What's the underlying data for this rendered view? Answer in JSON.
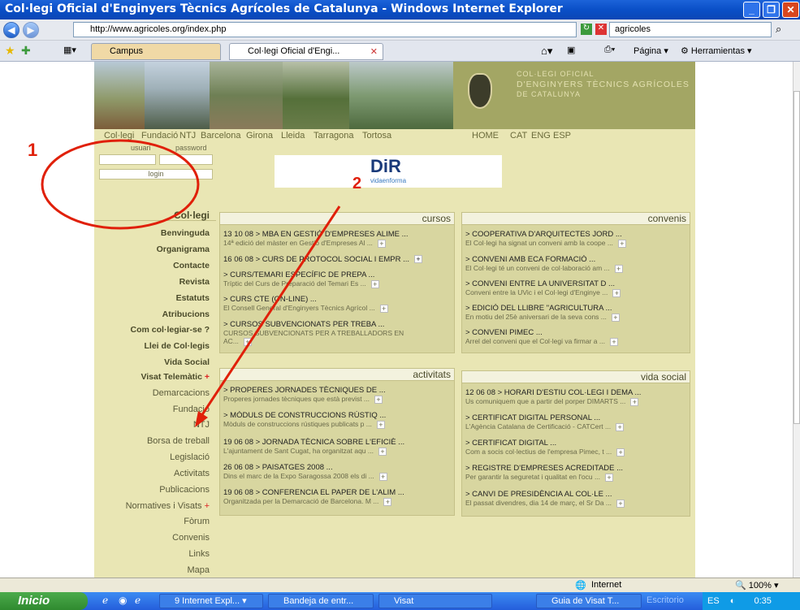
{
  "window": {
    "title": "Col·legi Oficial d'Enginyers Tècnics Agrícoles de Catalunya - Windows Internet Explorer"
  },
  "address": {
    "url": "http://www.agricoles.org/index.php",
    "search_value": "agricoles"
  },
  "tabs": {
    "campus": "Campus",
    "active": "Col·legi Oficial d'Engi...",
    "pagina": "Página",
    "herramientas": "Herramientas"
  },
  "site": {
    "logo_text": [
      "COL·LEGI OFICIAL",
      "D'ENGINYERS TÈCNICS AGRÍCOLES",
      "DE CATALUNYA"
    ],
    "topnav": [
      "Col·legi",
      "Fundació",
      "NTJ",
      "Barcelona",
      "Girona",
      "Lleida",
      "Tarragona",
      "Tortosa"
    ],
    "topnav_right": [
      "HOME",
      "CAT",
      "ENG",
      "ESP"
    ],
    "login": {
      "user_label": "usuari",
      "pass_label": "password",
      "button": "login"
    },
    "banner_ad": {
      "title": "DiR",
      "subtitle": "vidaenforma"
    },
    "sidebar_title": "Col·legi",
    "sidebar": [
      "Benvinguda",
      "Organigrama",
      "Contacte",
      "Revista",
      "Estatuts",
      "Atribucions",
      "Com col·legiar-se ?",
      "Llei de Col·legis",
      "Vida Social",
      "Visat Telemàtic"
    ],
    "sidebar2": [
      "Demarcacions",
      "Fundació",
      "NTJ",
      "Borsa de treball",
      "Legislació",
      "Activitats",
      "Publicacions",
      "Normatives i Visats",
      "Fòrum",
      "Convenis",
      "Links",
      "Mapa"
    ],
    "cursos": {
      "title": "cursos",
      "items": [
        {
          "t": "13 10 08 > MBA EN GESTIÓ D'EMPRESES ALIME ...",
          "d": "14ª edició del màster en Gestió d'Empreses Al ..."
        },
        {
          "t": "16 06 08 > CURS DE PROTOCOL SOCIAL I EMPR ...",
          "d": ""
        },
        {
          "t": "> CURS/TEMARI ESPECÍFIC DE PREPA ...",
          "d": "Tríptic del Curs de Preparació del Temari Es ..."
        },
        {
          "t": "> CURS CTE (ON-LINE) ...",
          "d": "El Consell General d'Enginyers Tècnics Agrícol ..."
        },
        {
          "t": "> CURSOS SUBVENCIONATS PER TREBA ...",
          "d": "CURSOS SUBVENCIONATS PER A TREBALLADORS EN"
        },
        {
          "t": "",
          "d": "AC..."
        }
      ]
    },
    "convenis": {
      "title": "convenis",
      "items": [
        {
          "t": "> COOPERATIVA D'ARQUITECTES JORD ...",
          "d": "El Col·legi ha signat un conveni amb la coope ..."
        },
        {
          "t": "> CONVENI AMB ECA FORMACIÓ ...",
          "d": "El Col·legi té un conveni de col·laboració am ..."
        },
        {
          "t": "> CONVENI ENTRE LA UNIVERSITAT D ...",
          "d": "Conveni entre la UVic i el Col·legi d'Enginye ..."
        },
        {
          "t": "> EDICIÓ DEL LLIBRE \"AGRICULTURA ...",
          "d": "En motiu del 25è aniversari de la seva cons ..."
        },
        {
          "t": "> CONVENI PIMEC ...",
          "d": "Arrel del conveni que el Col·legi va firmar a ..."
        }
      ]
    },
    "activitats": {
      "title": "activitats",
      "items": [
        {
          "t": "> PROPERES JORNADES TÈCNIQUES DE ...",
          "d": "Properes jornades tècniques que està previst ..."
        },
        {
          "t": "> MÒDULS DE CONSTRUCCIONS RÚSTIQ ...",
          "d": "Mòduls de construccions rústiques publicats p ..."
        },
        {
          "t": "19 06 08 > JORNADA TÈCNICA SOBRE L'EFICIÈ ...",
          "d": "L'ajuntament de Sant Cugat, ha organitzat aqu ..."
        },
        {
          "t": "26 06 08 > PAISATGES 2008 ...",
          "d": "Dins el marc de la Expo Saragossa 2008 els di ..."
        },
        {
          "t": "19 06 08 > CONFERENCIA EL PAPER DE L'ALIM ...",
          "d": "Organitzada per la Demarcació de Barcelona. M ..."
        }
      ]
    },
    "vida_social": {
      "title": "vida social",
      "items": [
        {
          "t": "12 06 08 > HORARI D'ESTIU COL·LEGI I DEMA ...",
          "d": "Us comuniquem que a partir del porper DIMARTS ..."
        },
        {
          "t": "> CERTIFICAT DIGITAL PERSONAL ...",
          "d": "L'Agència Catalana de Certificació - CATCert ..."
        },
        {
          "t": "> CERTIFICAT DIGITAL ...",
          "d": "Com a socis col·lectius de l'empresa Pimec, t ..."
        },
        {
          "t": "> REGISTRE D'EMPRESES ACREDITADE ...",
          "d": "Per garantir la seguretat i qualitat en l'ocu ..."
        },
        {
          "t": "> CANVI DE PRESIDÈNCIA AL COL·LE ...",
          "d": "El passat divendres, dia 14 de març, el Sr Da ..."
        }
      ]
    }
  },
  "annotations": {
    "one": "1",
    "two": "2"
  },
  "status": {
    "zone": "Internet",
    "zoom": "100%"
  },
  "taskbar": {
    "start": "Inicio",
    "tasks": [
      "9 Internet Expl...",
      "Bandeja de entr...",
      "Visat",
      "Guia de Visat T...",
      "Escritorio"
    ],
    "lang": "ES",
    "clock": "0:35"
  }
}
